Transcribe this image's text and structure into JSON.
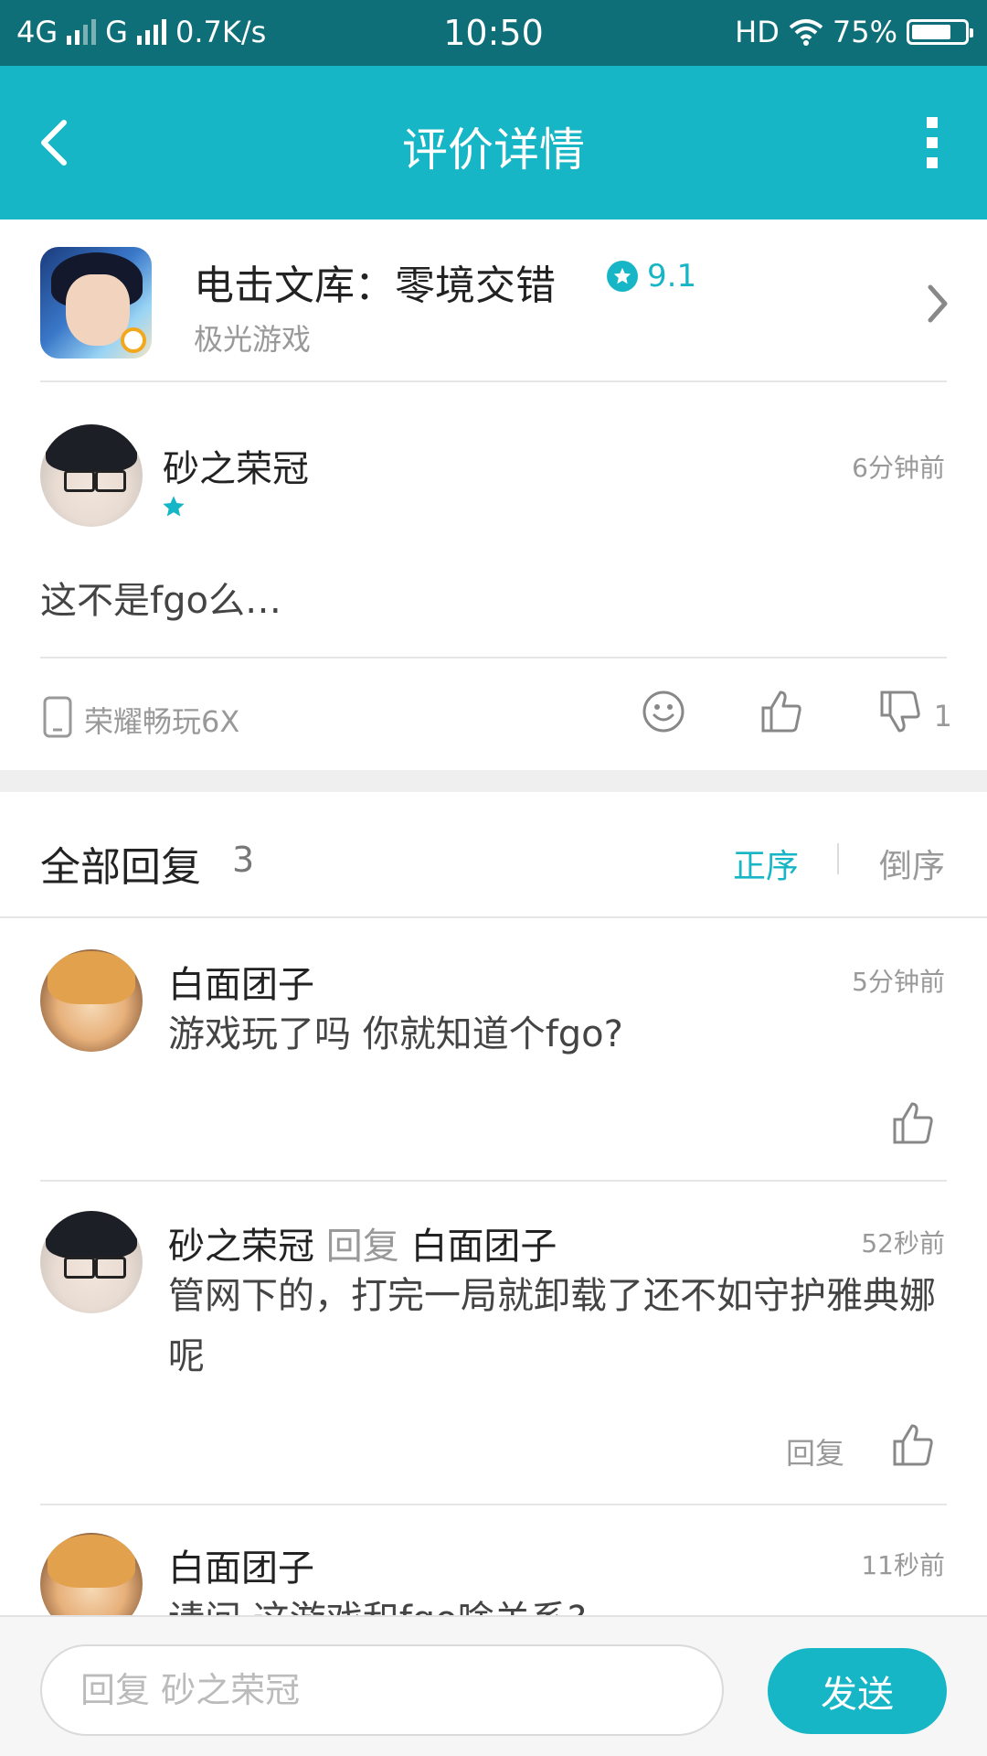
{
  "status_bar": {
    "network": "4G",
    "network2": "G",
    "speed": "0.7K/s",
    "time": "10:50",
    "hd": "HD",
    "battery_text": "75%",
    "battery_level": 0.75
  },
  "header": {
    "title": "评价详情"
  },
  "game": {
    "name": "电击文库：零境交错",
    "score": "9.1",
    "developer": "极光游戏"
  },
  "review": {
    "author": "砂之荣冠",
    "stars": 1,
    "time": "6分钟前",
    "body": "这不是fgo么…",
    "device": "荣耀畅玩6X",
    "dislike_count": "1"
  },
  "replies_section": {
    "title": "全部回复",
    "count": "3",
    "sort_asc": "正序",
    "sort_desc": "倒序"
  },
  "replies": [
    {
      "author": "白面团子",
      "time": "5分钟前",
      "body": "游戏玩了吗 你就知道个fgo?"
    },
    {
      "author": "砂之荣冠",
      "reply_word": "回复",
      "reply_to": "白面团子",
      "time": "52秒前",
      "body": "管网下的，打完一局就卸载了还不如守护雅典娜呢",
      "action": "回复"
    },
    {
      "author": "白面团子",
      "time": "11秒前",
      "body": "请问 这游戏和fgo啥关系?"
    }
  ],
  "composer": {
    "placeholder": "回复 砂之荣冠",
    "send_label": "发送"
  },
  "colors": {
    "accent": "#17b6c6",
    "status_bar": "#0f6f78"
  }
}
